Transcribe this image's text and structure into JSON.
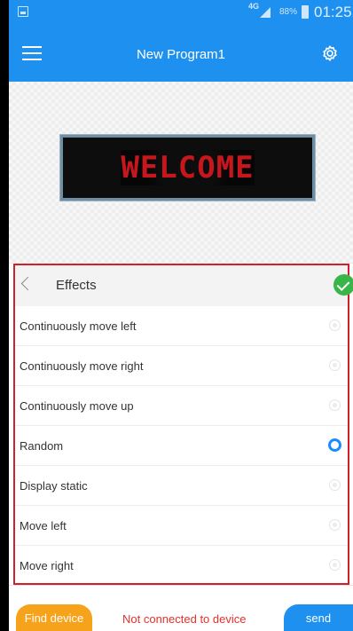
{
  "status_bar": {
    "network": "4G",
    "battery": "88%",
    "time": "01:25"
  },
  "app_bar": {
    "title": "New Program1"
  },
  "preview": {
    "led_text": "WELCOME",
    "led_color": "#c8161d"
  },
  "effects": {
    "title": "Effects",
    "items": [
      {
        "label": "Continuously move left",
        "selected": false
      },
      {
        "label": "Continuously move right",
        "selected": false
      },
      {
        "label": "Continuously move up",
        "selected": false
      },
      {
        "label": "Random",
        "selected": true
      },
      {
        "label": "Display static",
        "selected": false
      },
      {
        "label": "Move left",
        "selected": false
      },
      {
        "label": "Move right",
        "selected": false
      }
    ]
  },
  "footer": {
    "find_device": "Find device",
    "connection_status": "Not connected to device",
    "send": "send"
  },
  "colors": {
    "primary": "#1e90f0",
    "accent_orange": "#f7a21b",
    "error_red": "#e6302a",
    "confirm_green": "#39b54a"
  }
}
